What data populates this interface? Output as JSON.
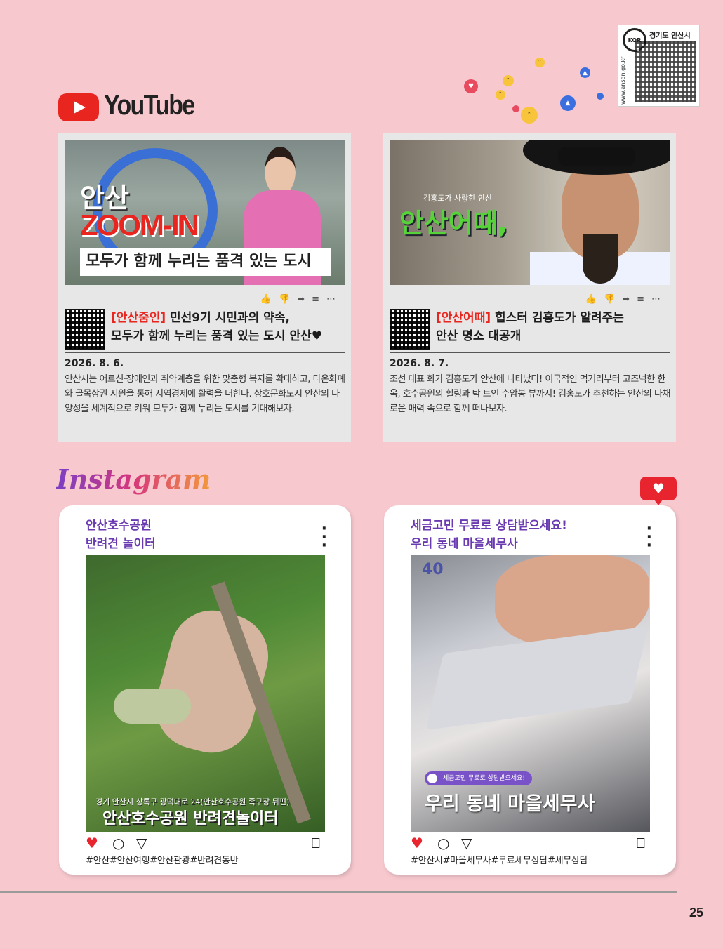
{
  "qr_badge": {
    "city": "경기도 안산시",
    "url": "www.ansan.go.kr",
    "kor": "KOR"
  },
  "youtube": {
    "brand": "YouTube",
    "videos": [
      {
        "thumb_line1": "안산",
        "thumb_line2": "ZOOM-IN",
        "thumb_banner": "모두가 함께 누리는 품격 있는 도시",
        "tag": "[안산줌인]",
        "title_rest": " 민선9기 시민과의 약속,",
        "title_line2": "모두가 함께 누리는 품격 있는 도시 안산♥",
        "date": "2026. 8. 6.",
        "desc": "안산시는 어르신·장애인과 취약계층을 위한 맞춤형 복지를 확대하고, 다온화폐와 골목상권 지원을 통해 지역경제에 활력을 더한다. 상호문화도시 안산의 다양성을 세계적으로 키워 모두가 함께 누리는 도시를 기대해보자."
      },
      {
        "thumb_sub": "김홍도가 사랑한 안산",
        "thumb_title": "안산어때,",
        "tag": "[안산어때]",
        "title_rest": " 힙스터 김홍도가 알려주는",
        "title_line2": "안산 명소 대공개",
        "date": "2026. 8. 7.",
        "desc": "조선 대표 화가 김홍도가 안산에 나타났다! 이국적인 먹거리부터 고즈넉한 한옥, 호수공원의 힐링과 탁 트인 수암봉 뷰까지! 김홍도가 추천하는 안산의 다채로운 매력 속으로 함께 떠나보자."
      }
    ],
    "action_icons": [
      "thumbs-up-icon",
      "thumbs-down-icon",
      "share-icon",
      "add-to-playlist-icon",
      "more-icon"
    ]
  },
  "instagram": {
    "brand": "Instagram",
    "posts": [
      {
        "title_line1": "안산호수공원",
        "title_line2": "반려견 놀이터",
        "caption_small": "경기 안산시 상록구 광덕대로 24(안산호수공원 족구장 뒤편)",
        "caption_big": "안산호수공원 반려견놀이터",
        "tags": "#안산#안산여행#안산관광#반려견동반"
      },
      {
        "title_line1": "세금고민 무료로 상담받으세요!",
        "title_line2": "우리 동네 마을세무사",
        "logo": "40",
        "pill": "세금고민 무료로 상담받으세요!",
        "caption_big": "우리 동네 마을세무사",
        "tags": "#안산시#마을세무사#무료세무상담#세무상담"
      }
    ]
  },
  "colors": {
    "youtube_red": "#e8251e",
    "instagram_purple": "#6a3ab1",
    "background": "#f7c9cf"
  },
  "page_number": "25"
}
